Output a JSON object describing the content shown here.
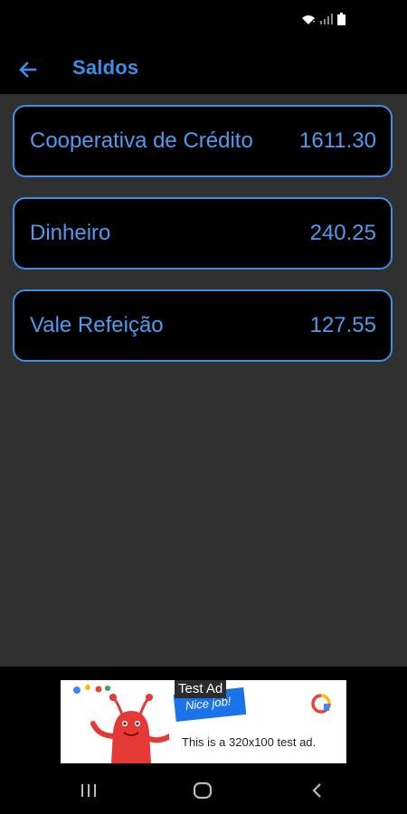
{
  "app_bar": {
    "title": "Saldos"
  },
  "balances": [
    {
      "label": "Cooperativa de Crédito",
      "value": "1611.30"
    },
    {
      "label": "Dinheiro",
      "value": "240.25"
    },
    {
      "label": "Vale Refeição",
      "value": "127.55"
    }
  ],
  "ad": {
    "badge": "Test Ad",
    "headline": "Nice job!",
    "text": "This is a 320x100 test ad."
  },
  "colors": {
    "accent": "#3b8fe6",
    "background": "#303030",
    "card_background": "#000000"
  },
  "icons": {
    "back": "back-arrow-icon",
    "status": [
      "wifi-icon",
      "signal-icon",
      "battery-icon"
    ],
    "ad_mascot": "red-monster-icon",
    "ad_logo": "ads-logo-icon",
    "nav": [
      "recents-icon",
      "home-icon",
      "back-nav-icon"
    ]
  }
}
